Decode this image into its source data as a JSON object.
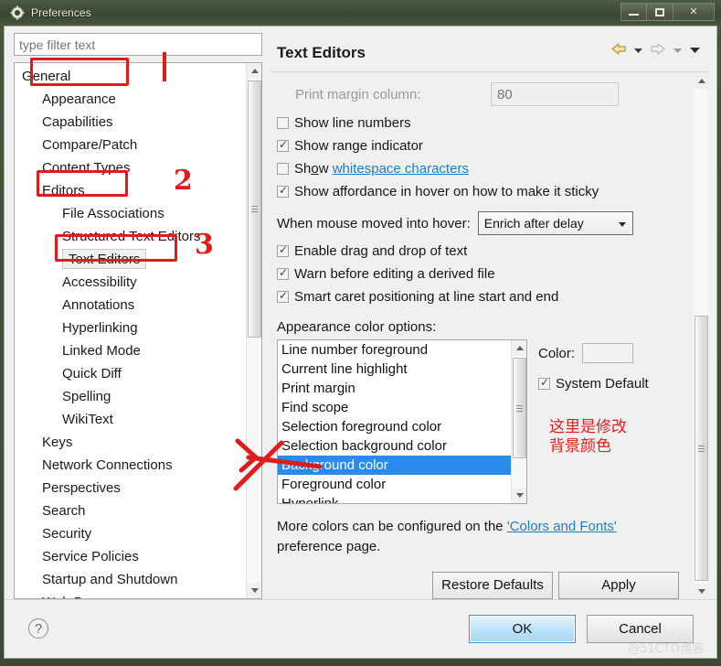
{
  "window": {
    "title": "Preferences",
    "icon": "gear-icon",
    "buttons": {
      "minimize": "–",
      "maximize": "□",
      "close": "✕"
    }
  },
  "sidebar": {
    "filter_placeholder": "type filter text",
    "filter_value": "",
    "items": [
      {
        "label": "General",
        "level": 1
      },
      {
        "label": "Appearance",
        "level": 2
      },
      {
        "label": "Capabilities",
        "level": 2
      },
      {
        "label": "Compare/Patch",
        "level": 2
      },
      {
        "label": "Content Types",
        "level": 2
      },
      {
        "label": "Editors",
        "level": 2
      },
      {
        "label": "File Associations",
        "level": 3
      },
      {
        "label": "Structured Text Editors",
        "level": 3
      },
      {
        "label": "Text Editors",
        "level": 3,
        "selected": true
      },
      {
        "label": "Accessibility",
        "level": 3
      },
      {
        "label": "Annotations",
        "level": 3
      },
      {
        "label": "Hyperlinking",
        "level": 3
      },
      {
        "label": "Linked Mode",
        "level": 3
      },
      {
        "label": "Quick Diff",
        "level": 3
      },
      {
        "label": "Spelling",
        "level": 3
      },
      {
        "label": "WikiText",
        "level": 3
      },
      {
        "label": "Keys",
        "level": 2
      },
      {
        "label": "Network Connections",
        "level": 2
      },
      {
        "label": "Perspectives",
        "level": 2
      },
      {
        "label": "Search",
        "level": 2
      },
      {
        "label": "Security",
        "level": 2
      },
      {
        "label": "Service Policies",
        "level": 2
      },
      {
        "label": "Startup and Shutdown",
        "level": 2
      },
      {
        "label": "Web Browser",
        "level": 2
      }
    ]
  },
  "main": {
    "title": "Text Editors",
    "nav": {
      "back_icon": "back-arrow-icon",
      "back_dropdown_icon": "chevron-down-icon",
      "forward_icon": "forward-arrow-icon",
      "forward_dropdown_icon": "chevron-down-icon",
      "menu_icon": "chevron-down-icon"
    },
    "print_margin": {
      "label": "Print margin column:",
      "value": "80",
      "disabled": true
    },
    "checkboxes": [
      {
        "label": "Show line numbers",
        "checked": false
      },
      {
        "label": "Show range indicator",
        "checked": true
      },
      {
        "label": "Show ",
        "link": "whitespace characters",
        "checked": false,
        "mnemonic": "o"
      },
      {
        "label": "Show affordance in hover on how to make it sticky",
        "checked": true
      },
      {
        "label": "Enable drag and drop of text",
        "checked": true
      },
      {
        "label": "Warn before editing a derived file",
        "checked": true
      },
      {
        "label": "Smart caret positioning at line start and end",
        "checked": true
      }
    ],
    "hover": {
      "label": "When mouse moved into hover:",
      "selected": "Enrich after delay"
    },
    "appearance": {
      "label": "Appearance color options:",
      "options": [
        "Line number foreground",
        "Current line highlight",
        "Print margin",
        "Find scope",
        "Selection foreground color",
        "Selection background color",
        "Background color",
        "Foreground color",
        "Hyperlink"
      ],
      "selected": "Background color",
      "color_label": "Color:",
      "color_value": "",
      "system_default_label": "System Default",
      "system_default_checked": true
    },
    "more_colors_prefix": "More colors can be configured on the ",
    "more_colors_link": "'Colors and Fonts'",
    "more_colors_suffix": " preference page.",
    "restore_defaults_label": "Restore Defaults",
    "apply_label": "Apply"
  },
  "footer": {
    "help_icon": "question-mark-icon",
    "ok_label": "OK",
    "cancel_label": "Cancel",
    "watermark": "@51CTO博客"
  },
  "annotations": {
    "number_1": "1",
    "number_2": "2",
    "number_3": "3",
    "chinese_note": "这里是修改\n背景颜色",
    "color": "#e01b1b"
  }
}
